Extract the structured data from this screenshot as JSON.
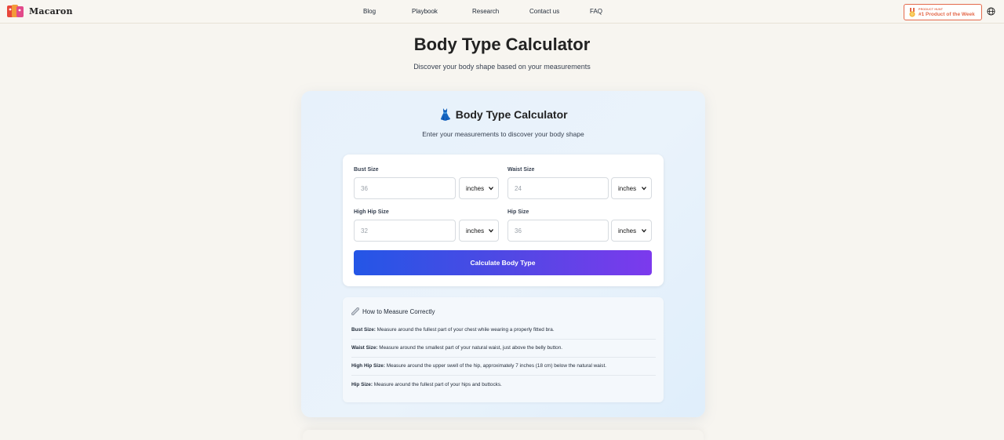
{
  "brand": {
    "name": "Macaron"
  },
  "nav": {
    "items": [
      {
        "label": "Blog"
      },
      {
        "label": "Playbook"
      },
      {
        "label": "Research"
      },
      {
        "label": "Contact us"
      },
      {
        "label": "FAQ"
      }
    ]
  },
  "badge": {
    "small": "PRODUCT HUNT",
    "big": "#1 Product of the Week"
  },
  "header": {
    "title": "Body Type Calculator",
    "subtitle": "Discover your body shape based on your measurements"
  },
  "calculator": {
    "title": "👗 Body Type Calculator",
    "subtitle": "Enter your measurements to discover your body shape",
    "fields": {
      "bust": {
        "label": "Bust Size",
        "placeholder": "36",
        "unit": "inches"
      },
      "waist": {
        "label": "Waist Size",
        "placeholder": "24",
        "unit": "inches"
      },
      "high_hip": {
        "label": "High Hip Size",
        "placeholder": "32",
        "unit": "inches"
      },
      "hip": {
        "label": "Hip Size",
        "placeholder": "36",
        "unit": "inches"
      }
    },
    "button": "Calculate Body Type"
  },
  "howto": {
    "title": "How to Measure Correctly",
    "tips": [
      {
        "term": "Bust Size:",
        "text": " Measure around the fullest part of your chest while wearing a properly fitted bra."
      },
      {
        "term": "Waist Size:",
        "text": " Measure around the smallest part of your natural waist, just above the belly button."
      },
      {
        "term": "High Hip Size:",
        "text": " Measure around the upper swell of the hip, approximately 7 inches (18 cm) below the natural waist."
      },
      {
        "term": "Hip Size:",
        "text": " Measure around the fullest part of your hips and buttocks."
      }
    ]
  },
  "colors": {
    "accent_start": "#2456e6",
    "accent_end": "#7c3aed",
    "badge": "#e46a4c"
  }
}
